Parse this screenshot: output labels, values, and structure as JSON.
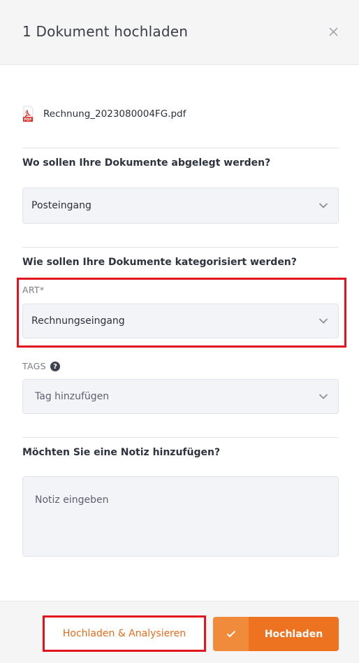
{
  "header": {
    "title": "1 Dokument hochladen"
  },
  "file": {
    "name": "Rechnung_2023080004FG.pdf",
    "icon": "pdf-file-icon",
    "icon_badge": "PDF"
  },
  "location": {
    "question": "Wo sollen Ihre Dokumente abgelegt werden?",
    "selected": "Posteingang"
  },
  "categorize": {
    "question": "Wie sollen Ihre Dokumente kategorisiert werden?",
    "art_label": "ART*",
    "art_selected": "Rechnungseingang",
    "tags_label": "TAGS",
    "tags_help": "?",
    "tags_placeholder": "Tag hinzufügen"
  },
  "note": {
    "question": "Möchten Sie eine Notiz hinzufügen?",
    "placeholder": "Notiz eingeben"
  },
  "footer": {
    "analyse_label": "Hochladen & Analysieren",
    "upload_label": "Hochladen"
  },
  "colors": {
    "accent": "#ee7320",
    "accent_light": "#f18b3c",
    "highlight": "#e2141e",
    "pdf_red": "#d7322a"
  }
}
